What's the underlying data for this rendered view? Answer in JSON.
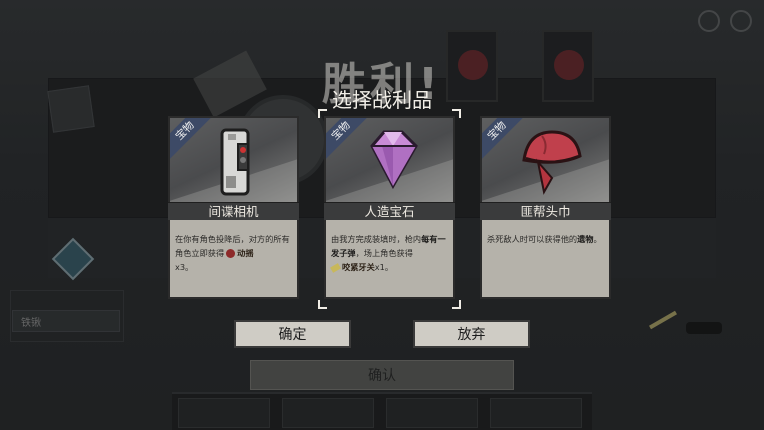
{
  "screen": {
    "victory_title": "胜利!",
    "subtitle": "选择战利品"
  },
  "background": {
    "confirm_label": "确认",
    "left_pill_label": "铁锹"
  },
  "cards": [
    {
      "badge": "宝物",
      "name": "间谍相机",
      "icon": "spy-camera-icon",
      "desc_text": "在你有角色投降后，对方的所有角色立即获得",
      "desc_keyword": "动摇",
      "desc_tail": "x3。",
      "selected": false
    },
    {
      "badge": "宝物",
      "name": "人造宝石",
      "icon": "gem-icon",
      "desc_text_a": "由我方完成装填时，枪内",
      "desc_bold_a": "每有一发子弹",
      "desc_text_b": "，场上角色获得",
      "desc_keyword": "咬紧牙关",
      "desc_tail": "x1。",
      "selected": true
    },
    {
      "badge": "宝物",
      "name": "匪帮头巾",
      "icon": "bandana-icon",
      "desc_text": "杀死敌人时可以获得他的",
      "desc_bold": "遗物",
      "desc_tail": "。",
      "selected": false
    }
  ],
  "buttons": {
    "confirm": "确定",
    "abandon": "放弃"
  },
  "colors": {
    "badge": "#3d4a66",
    "card_desc_bg": "#b5b2aa",
    "button_bg": "#cfccc5",
    "gem": "#c98bd6",
    "bandana": "#c0404c"
  }
}
